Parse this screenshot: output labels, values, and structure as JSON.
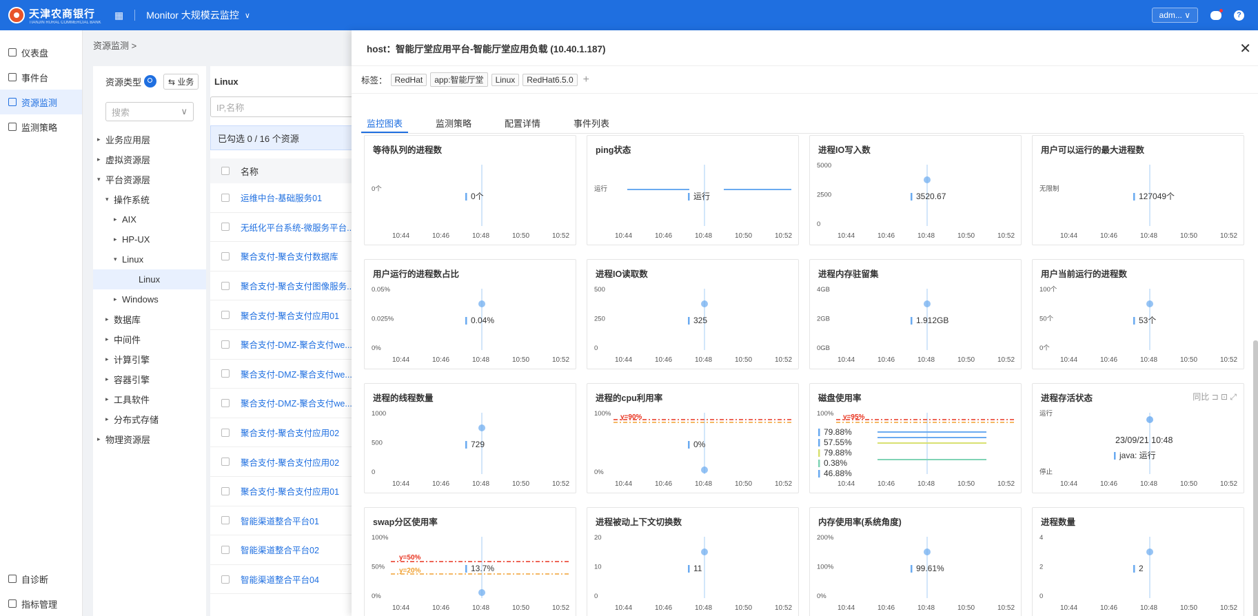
{
  "topbar": {
    "logo_text": "天津农商银行",
    "logo_sub": "TIANJIN RURAL COMMERCIAL BANK",
    "app_title": "Monitor 大规模云监控",
    "user": "adm...",
    "help": "?"
  },
  "nav": {
    "items": [
      {
        "label": "仪表盘"
      },
      {
        "label": "事件台"
      },
      {
        "label": "资源监测"
      },
      {
        "label": "监测策略"
      }
    ],
    "bottom": [
      {
        "label": "自诊断"
      },
      {
        "label": "指标管理"
      }
    ]
  },
  "breadcrumb": "资源监测  >",
  "tree": {
    "header": "资源类型",
    "biz_button": "⇆ 业务",
    "search_placeholder": "搜索",
    "nodes": [
      {
        "label": "业务应用层",
        "caret": "▸"
      },
      {
        "label": "虚拟资源层",
        "caret": "▸"
      },
      {
        "label": "平台资源层",
        "caret": "▾"
      },
      {
        "label": "操作系统",
        "caret": "▾"
      },
      {
        "label": "AIX",
        "caret": "▸"
      },
      {
        "label": "HP-UX",
        "caret": "▸"
      },
      {
        "label": "Linux",
        "caret": "▾"
      },
      {
        "label": "Linux",
        "caret": ""
      },
      {
        "label": "Windows",
        "caret": "▸"
      },
      {
        "label": "数据库",
        "caret": "▸"
      },
      {
        "label": "中间件",
        "caret": "▸"
      },
      {
        "label": "计算引擎",
        "caret": "▸"
      },
      {
        "label": "容器引擎",
        "caret": "▸"
      },
      {
        "label": "工具软件",
        "caret": "▸"
      },
      {
        "label": "分布式存储",
        "caret": "▸"
      },
      {
        "label": "物理资源层",
        "caret": "▸"
      }
    ]
  },
  "list": {
    "title": "Linux",
    "search_placeholder": "IP,名称",
    "selected_info": "已勾选 0 / 16 个资源",
    "col_name": "名称",
    "rows": [
      "运维中台-基础服务01",
      "无纸化平台系统-微服务平台...",
      "聚合支付-聚合支付数据库",
      "聚合支付-聚合支付图像服务...",
      "聚合支付-聚合支付应用01",
      "聚合支付-DMZ-聚合支付we...",
      "聚合支付-DMZ-聚合支付we...",
      "聚合支付-DMZ-聚合支付we...",
      "聚合支付-聚合支付应用02",
      "聚合支付-聚合支付应用02",
      "聚合支付-聚合支付应用01",
      "智能渠道整合平台01",
      "智能渠道整合平台02",
      "智能渠道整合平台04"
    ]
  },
  "drawer": {
    "title": "host：智能厅堂应用平台-智能厅堂应用负载 (10.40.1.187)",
    "close": "✕",
    "tags_label": "标签：",
    "tags": [
      "RedHat",
      "app:智能厅堂",
      "Linux",
      "RedHat6.5.0"
    ],
    "tag_add": "+",
    "tabs": [
      "监控图表",
      "监测策略",
      "配置详情",
      "事件列表"
    ]
  },
  "charts": {
    "x_ticks": [
      "10:44",
      "10:46",
      "10:48",
      "10:50",
      "10:52"
    ],
    "cards": [
      {
        "title": "等待队列的进程数",
        "y_ticks": [
          "0个"
        ],
        "values": [
          "0个"
        ],
        "kind": "flat"
      },
      {
        "title": "ping状态",
        "y_ticks": [
          "运行"
        ],
        "values": [
          "运行"
        ],
        "kind": "status"
      },
      {
        "title": "进程IO写入数",
        "y_ticks": [
          "5000",
          "2500",
          "0"
        ],
        "values": [
          "3520.67"
        ],
        "kind": "point"
      },
      {
        "title": "用户可以运行的最大进程数",
        "y_ticks": [
          "无限制"
        ],
        "values": [
          "127049个"
        ],
        "kind": "flat"
      },
      {
        "title": "用户运行的进程数占比",
        "y_ticks": [
          "0.05%",
          "0.025%",
          "0%"
        ],
        "values": [
          "0.04%"
        ],
        "kind": "point"
      },
      {
        "title": "进程IO读取数",
        "y_ticks": [
          "500",
          "250",
          "0"
        ],
        "values": [
          "325"
        ],
        "kind": "point"
      },
      {
        "title": "进程内存驻留集",
        "y_ticks": [
          "4GB",
          "2GB",
          "0GB"
        ],
        "values": [
          "1.912GB"
        ],
        "kind": "point"
      },
      {
        "title": "用户当前运行的进程数",
        "y_ticks": [
          "100个",
          "50个",
          "0个"
        ],
        "values": [
          "53个"
        ],
        "kind": "point"
      },
      {
        "title": "进程的线程数量",
        "y_ticks": [
          "1000",
          "500",
          "0"
        ],
        "values": [
          "729"
        ],
        "kind": "point"
      },
      {
        "title": "进程的cpu利用率",
        "y_ticks": [
          "100%",
          "0%"
        ],
        "values": [
          "0%"
        ],
        "threshold": "y=90%",
        "kind": "threshold"
      },
      {
        "title": "磁盘使用率",
        "y_ticks": [
          "100%"
        ],
        "values": [
          "79.88%",
          "57.55%",
          "79.88%",
          "0.38%",
          "46.88%"
        ],
        "threshold": "y=95%",
        "kind": "multi"
      },
      {
        "title": "进程存活状态",
        "y_ticks": [
          "运行",
          "停止"
        ],
        "values": [
          "java: 运行"
        ],
        "tooltip_time": "23/09/21 10:48",
        "tools": "同比",
        "kind": "alive"
      },
      {
        "title": "swap分区使用率",
        "y_ticks": [
          "100%",
          "50%",
          "0%"
        ],
        "values": [
          "13.7%"
        ],
        "threshold": "y=50%",
        "threshold2": "y=20%",
        "kind": "threshold2"
      },
      {
        "title": "进程被动上下文切换数",
        "y_ticks": [
          "20",
          "10",
          "0"
        ],
        "values": [
          "11"
        ],
        "kind": "point"
      },
      {
        "title": "内存使用率(系统角度)",
        "y_ticks": [
          "200%",
          "100%",
          "0%"
        ],
        "values": [
          "99.61%"
        ],
        "kind": "point"
      },
      {
        "title": "进程数量",
        "y_ticks": [
          "4",
          "2",
          "0"
        ],
        "values": [
          "2"
        ],
        "kind": "point"
      }
    ]
  },
  "colors": {
    "primary": "#1f6fe0",
    "series": "#6aaaf0",
    "threshold_red": "#e8321e",
    "threshold_orange": "#f0a030",
    "series_green": "#7fd3b5",
    "series_yellow": "#d8e070"
  }
}
